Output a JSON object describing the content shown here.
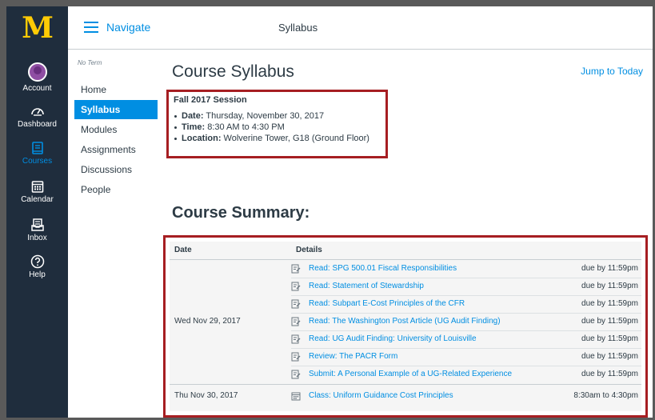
{
  "global_nav": {
    "logo": "M",
    "items": [
      {
        "label": "Account",
        "icon": "avatar"
      },
      {
        "label": "Dashboard",
        "icon": "dashboard-icon"
      },
      {
        "label": "Courses",
        "icon": "courses-icon",
        "active": true
      },
      {
        "label": "Calendar",
        "icon": "calendar-icon"
      },
      {
        "label": "Inbox",
        "icon": "inbox-icon"
      },
      {
        "label": "Help",
        "icon": "help-icon"
      }
    ]
  },
  "header": {
    "navigate_label": "Navigate",
    "breadcrumb": "Syllabus"
  },
  "course_nav": {
    "term": "No Term",
    "items": [
      "Home",
      "Syllabus",
      "Modules",
      "Assignments",
      "Discussions",
      "People"
    ],
    "active": "Syllabus"
  },
  "main": {
    "title": "Course Syllabus",
    "jump_label": "Jump to Today",
    "session": {
      "heading": "Fall 2017 Session",
      "items": [
        {
          "label": "Date:",
          "value": " Thursday, November 30, 2017"
        },
        {
          "label": "Time:",
          "value": " 8:30 AM to 4:30 PM"
        },
        {
          "label": "Location:",
          "value": " Wolverine Tower, G18 (Ground Floor)"
        }
      ]
    },
    "summary_title": "Course Summary:",
    "table": {
      "headers": {
        "date": "Date",
        "details": "Details"
      },
      "groups": [
        {
          "date": "Wed Nov 29, 2017",
          "events": [
            {
              "title": "Read: SPG 500.01 Fiscal Responsibilities",
              "due": "due by 11:59pm",
              "icon": "assignment-icon"
            },
            {
              "title": "Read: Statement of Stewardship",
              "due": "due by 11:59pm",
              "icon": "assignment-icon"
            },
            {
              "title": "Read: Subpart E-Cost Principles of the CFR",
              "due": "due by 11:59pm",
              "icon": "assignment-icon"
            },
            {
              "title": "Read: The Washington Post Article (UG Audit Finding)",
              "due": "due by 11:59pm",
              "icon": "assignment-icon"
            },
            {
              "title": "Read: UG Audit Finding: University of Louisville",
              "due": "due by 11:59pm",
              "icon": "assignment-icon"
            },
            {
              "title": "Review: The PACR Form",
              "due": "due by 11:59pm",
              "icon": "assignment-icon"
            },
            {
              "title": "Submit: A Personal Example of a UG-Related Experience",
              "due": "due by 11:59pm",
              "icon": "assignment-icon"
            }
          ]
        },
        {
          "date": "Thu Nov 30, 2017",
          "events": [
            {
              "title": "Class: Uniform Guidance Cost Principles",
              "due": "8:30am to 4:30pm",
              "icon": "calendar-event-icon"
            }
          ]
        }
      ]
    }
  }
}
